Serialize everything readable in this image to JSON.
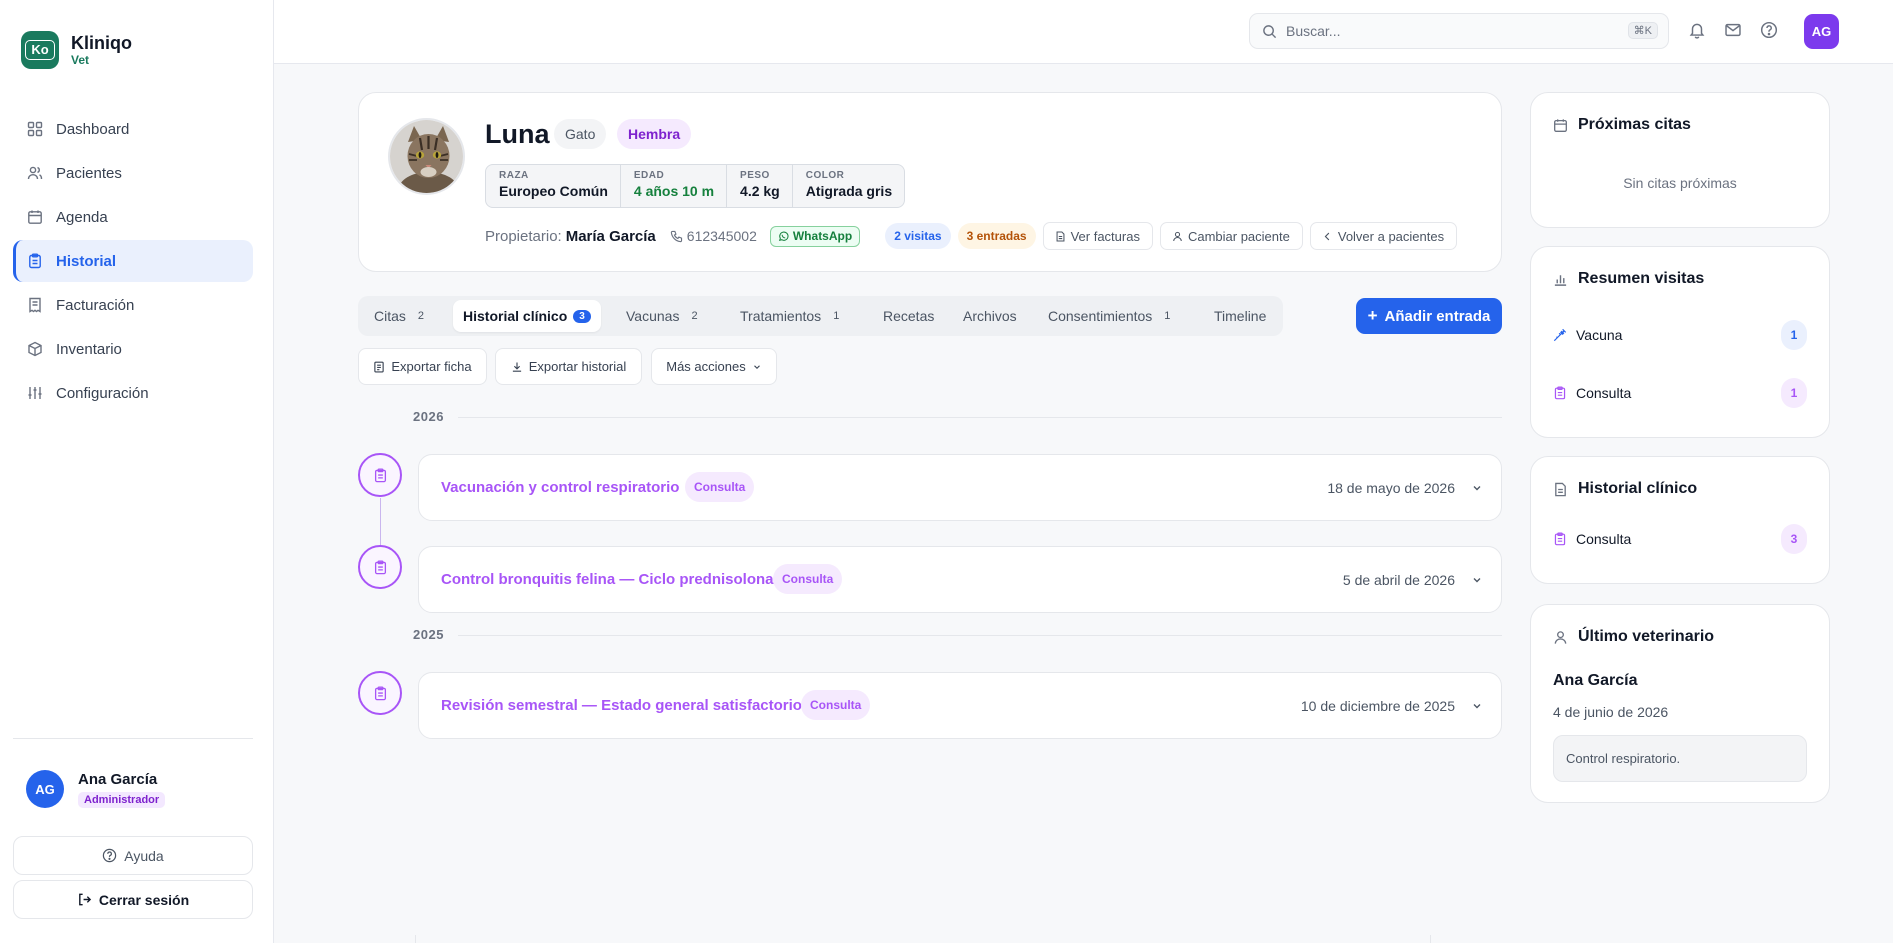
{
  "brand": {
    "name": "Kliniqo",
    "sub": "Vet",
    "logo_text": "Ko"
  },
  "nav": [
    {
      "label": "Dashboard",
      "icon": "grid-icon"
    },
    {
      "label": "Pacientes",
      "icon": "users-icon"
    },
    {
      "label": "Agenda",
      "icon": "calendar-icon"
    },
    {
      "label": "Historial",
      "icon": "clipboard-icon",
      "active": true
    },
    {
      "label": "Facturación",
      "icon": "receipt-icon"
    },
    {
      "label": "Inventario",
      "icon": "box-icon"
    },
    {
      "label": "Configuración",
      "icon": "sliders-icon"
    }
  ],
  "user": {
    "initials": "AG",
    "name": "Ana García",
    "role": "Administrador"
  },
  "sidebar_buttons": {
    "help": "Ayuda",
    "logout": "Cerrar sesión"
  },
  "topbar": {
    "search_placeholder": "Buscar...",
    "shortcut": "⌘K",
    "avatar": "AG"
  },
  "patient": {
    "name": "Luna",
    "species": "Gato",
    "sex": "Hembra",
    "stats": [
      {
        "label": "RAZA",
        "value": "Europeo Común"
      },
      {
        "label": "EDAD",
        "value": "4 años 10 m"
      },
      {
        "label": "PESO",
        "value": "4.2 kg"
      },
      {
        "label": "COLOR",
        "value": "Atigrada gris"
      }
    ],
    "owner_label": "Propietario:",
    "owner_name": "María García",
    "phone": "612345002",
    "whatsapp": "WhatsApp",
    "visits": "2 visitas",
    "entries": "3 entradas",
    "actions": {
      "invoices": "Ver facturas",
      "change": "Cambiar paciente",
      "back": "Volver a pacientes"
    }
  },
  "tabs": [
    {
      "label": "Citas",
      "count": "2"
    },
    {
      "label": "Historial clínico",
      "count": "3",
      "active": true
    },
    {
      "label": "Vacunas",
      "count": "2"
    },
    {
      "label": "Tratamientos",
      "count": "1"
    },
    {
      "label": "Recetas",
      "count": ""
    },
    {
      "label": "Archivos",
      "count": ""
    },
    {
      "label": "Consentimientos",
      "count": "1"
    },
    {
      "label": "Timeline",
      "count": ""
    }
  ],
  "add_entry": "Añadir entrada",
  "actions": {
    "export_file": "Exportar ficha",
    "export_history": "Exportar historial",
    "more": "Más acciones"
  },
  "timeline": {
    "years": [
      "2026",
      "2025"
    ],
    "entries": [
      {
        "title": "Vacunación y control respiratorio",
        "type": "Consulta",
        "date": "18 de mayo de 2026"
      },
      {
        "title": "Control bronquitis felina — Ciclo prednisolona",
        "type": "Consulta",
        "date": "5 de abril de 2026"
      },
      {
        "title": "Revisión semestral — Estado general satisfactorio",
        "type": "Consulta",
        "date": "10 de diciembre de 2025"
      }
    ]
  },
  "right": {
    "upcoming": {
      "title": "Próximas citas",
      "empty": "Sin citas próximas"
    },
    "summary": {
      "title": "Resumen visitas",
      "rows": [
        {
          "label": "Vacuna",
          "count": "1"
        },
        {
          "label": "Consulta",
          "count": "1"
        }
      ]
    },
    "history": {
      "title": "Historial clínico",
      "rows": [
        {
          "label": "Consulta",
          "count": "3"
        }
      ]
    },
    "last_vet": {
      "title": "Último veterinario",
      "name": "Ana García",
      "date": "4 de junio de 2026",
      "note": "Control respiratorio."
    }
  },
  "colors": {
    "primary": "#2563eb",
    "brand": "#1a7a5e",
    "consulta": "#a855f7",
    "success": "#15803d"
  }
}
